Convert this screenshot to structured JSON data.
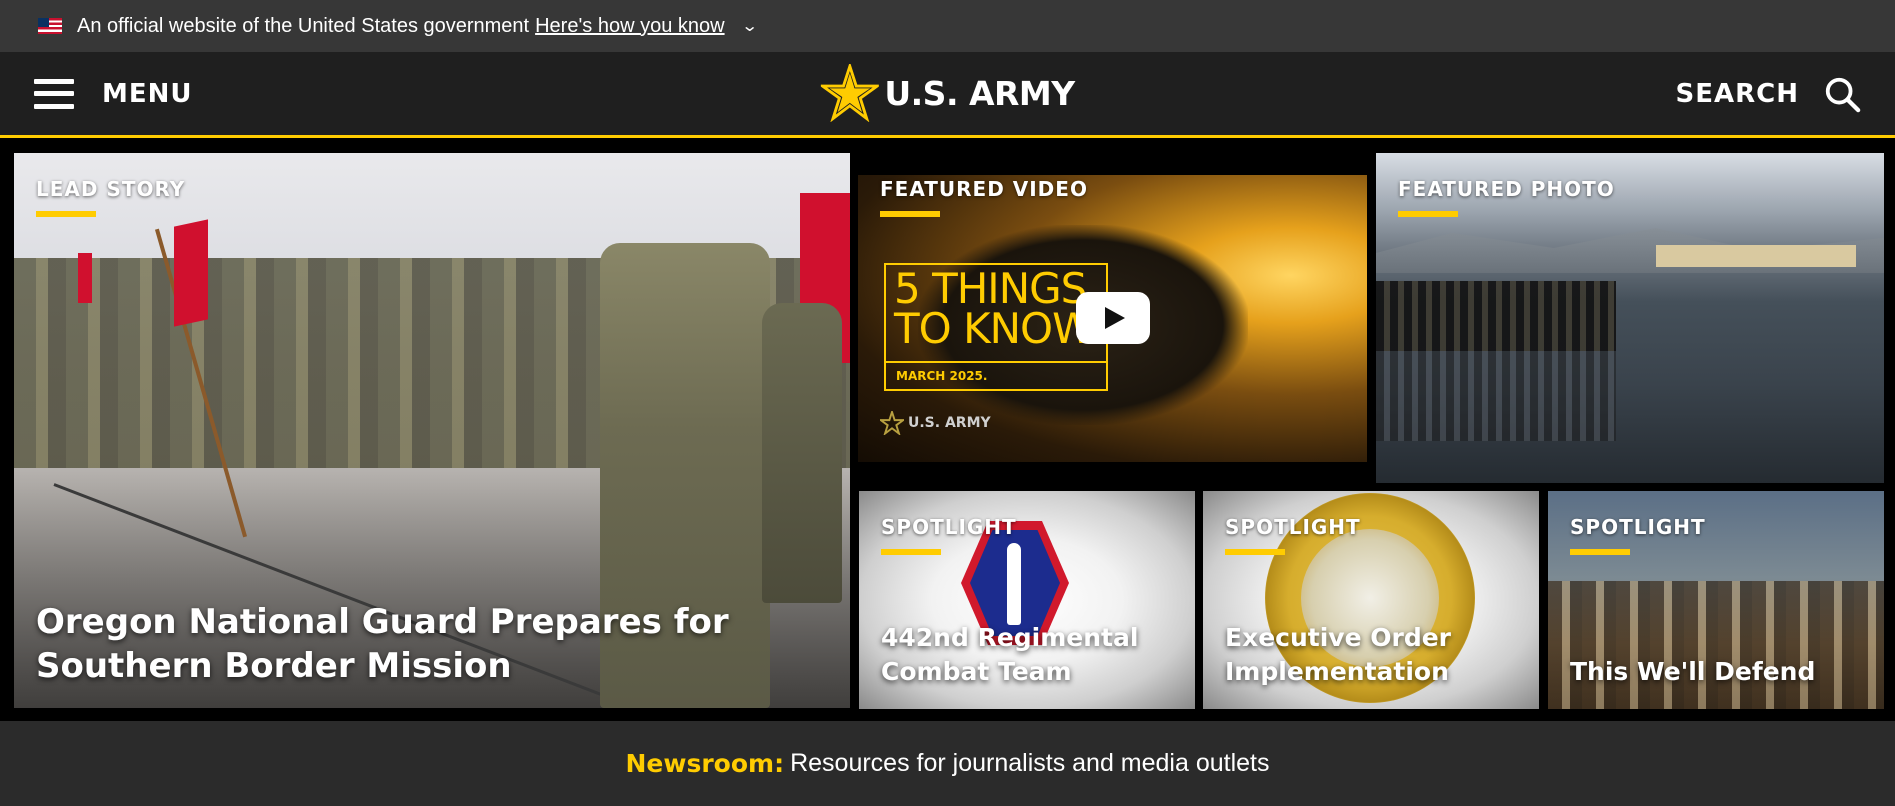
{
  "gov_banner": {
    "text": "An official website of the United States government",
    "link": "Here's how you know",
    "chevron": "⌄"
  },
  "header": {
    "menu_label": "MENU",
    "logo_text": "U.S. ARMY",
    "search_label": "SEARCH"
  },
  "tiles": {
    "lead": {
      "badge": "LEAD STORY",
      "headline": "Oregon National Guard Prepares for Southern Border Mission"
    },
    "video": {
      "badge": "FEATURED VIDEO",
      "overlay_title_line1": "5 THINGS",
      "overlay_title_line2": "TO KNOW.",
      "overlay_date": "MARCH 2025.",
      "overlay_logo": "U.S. ARMY"
    },
    "photo": {
      "badge": "FEATURED PHOTO"
    },
    "spotlights": [
      {
        "badge": "SPOTLIGHT",
        "headline_line1": "442nd Regimental",
        "headline_line2": "Combat Team"
      },
      {
        "badge": "SPOTLIGHT",
        "headline_line1": "Executive Order",
        "headline_line2": "Implementation"
      },
      {
        "badge": "SPOTLIGHT",
        "headline_line1": "",
        "headline_line2": "This We'll Defend"
      }
    ]
  },
  "newsroom": {
    "label": "Newsroom:",
    "description": "Resources for journalists and media outlets"
  },
  "colors": {
    "accent": "#ffcc01",
    "header_bg": "#1f1f1f",
    "banner_bg": "#373737"
  }
}
